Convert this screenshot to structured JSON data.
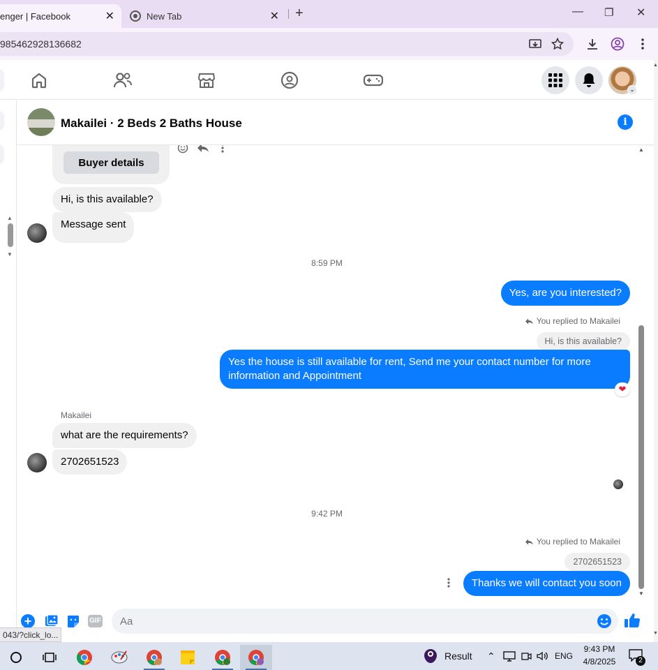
{
  "browser": {
    "tabs": [
      {
        "label": "enger | Facebook",
        "close": "✕"
      },
      {
        "label": "New Tab",
        "close": "✕"
      }
    ],
    "new_tab": "+",
    "url": "985462928136682",
    "window_controls": {
      "minimize": "—",
      "maximize": "❐",
      "close": "✕"
    }
  },
  "chat": {
    "title": "Makailei · 2 Beds 2 Baths House",
    "buyer_details_button": "Buyer details",
    "messages_in_top": [
      {
        "text": "Hi, is this available?"
      },
      {
        "text": "Message sent"
      }
    ],
    "timestamp_1": "8:59 PM",
    "out_1": "Yes, are you interested?",
    "reply_label_1": "You replied to Makailei",
    "reply_quote_1": "Hi, is this available?",
    "out_2": "Yes the house is still available for rent, Send me your contact number for more information and Appointment",
    "reaction_2": "❤",
    "sender_name": "Makailei",
    "in_3": "what are the requirements?",
    "in_4": "2702651523",
    "timestamp_2": "9:42 PM",
    "reply_label_2": "You replied to Makailei",
    "reply_quote_2": "2702651523",
    "out_3": "Thanks we will contact you soon",
    "composer_placeholder": "Aa",
    "gif_label": "GIF"
  },
  "status_url": "043/?click_lo...",
  "taskbar": {
    "result_label": "Result",
    "lang": "ENG",
    "time": "9:43 PM",
    "date": "4/8/2025",
    "notif_count": "2"
  },
  "colors": {
    "accent": "#0a7cff",
    "fb_blue": "#1877f2"
  }
}
